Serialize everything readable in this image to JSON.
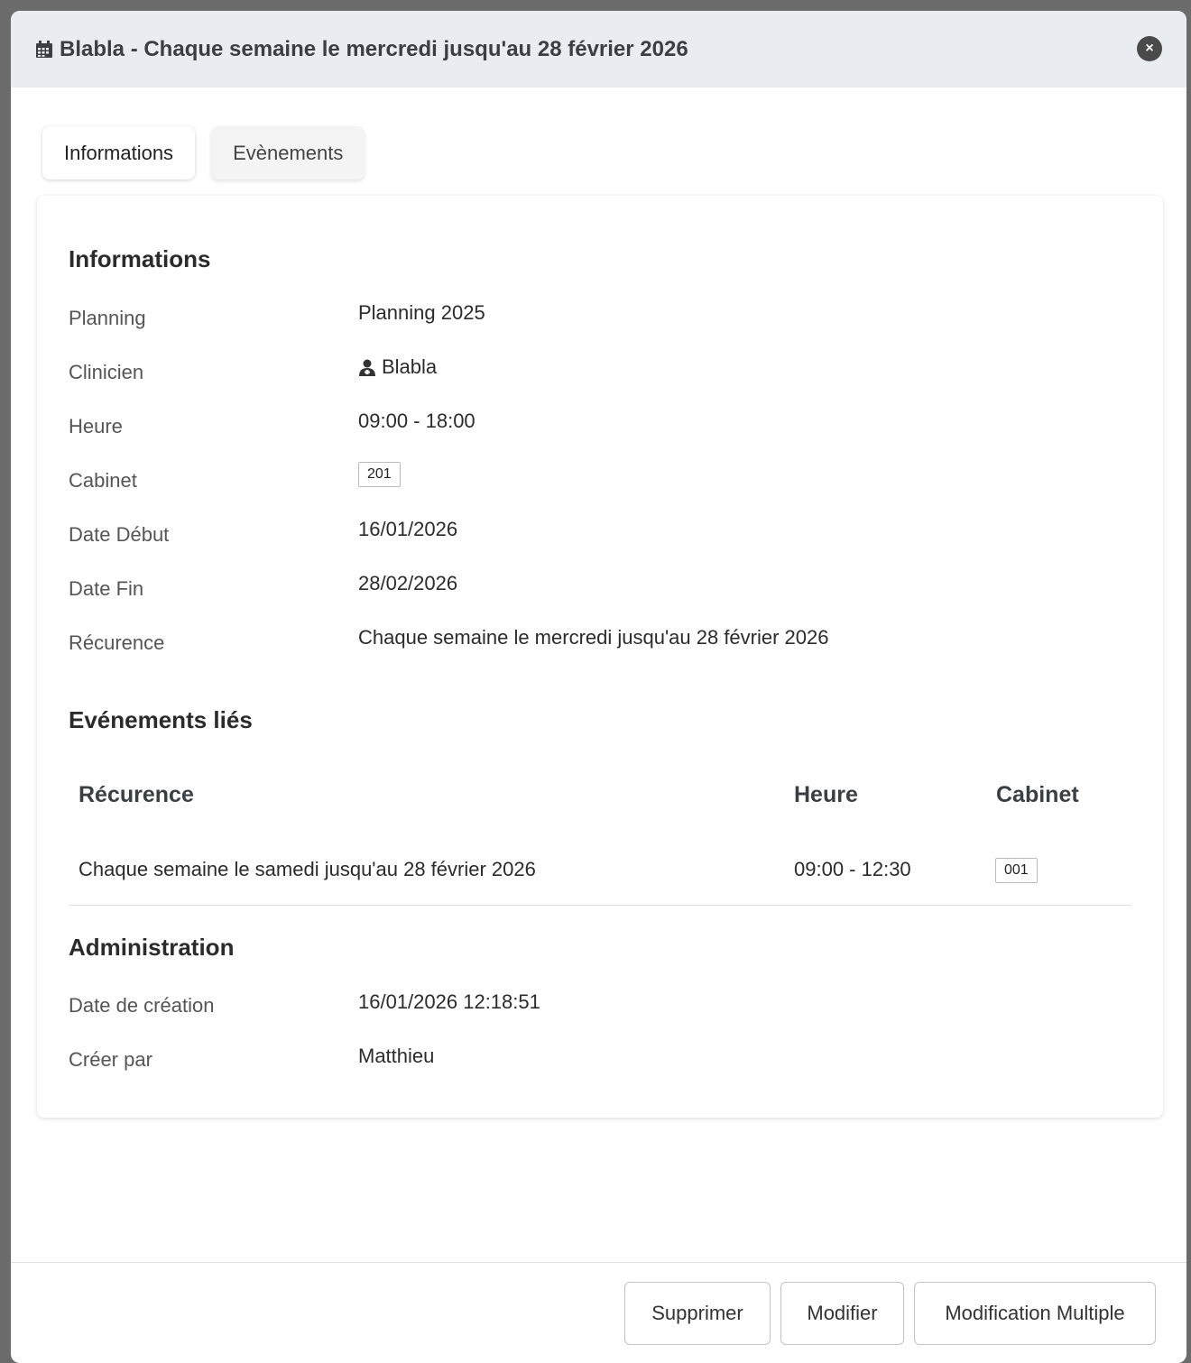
{
  "header": {
    "title": "Blabla - Chaque semaine le mercredi jusqu'au 28 février 2026",
    "close_icon": "×"
  },
  "tabs": [
    {
      "label": "Informations",
      "active": true
    },
    {
      "label": "Evènements",
      "active": false
    }
  ],
  "informations": {
    "title": "Informations",
    "rows": {
      "planning": {
        "label": "Planning",
        "value": "Planning 2025"
      },
      "clinicien": {
        "label": "Clinicien",
        "value": "Blabla"
      },
      "heure": {
        "label": "Heure",
        "value": "09:00 - 18:00"
      },
      "cabinet": {
        "label": "Cabinet",
        "value": "201"
      },
      "date_debut": {
        "label": "Date Début",
        "value": "16/01/2026"
      },
      "date_fin": {
        "label": "Date Fin",
        "value": "28/02/2026"
      },
      "recurrence": {
        "label": "Récurence",
        "value": "Chaque semaine le mercredi jusqu'au 28 février 2026"
      }
    }
  },
  "evenements_lies": {
    "title": "Evénements liés",
    "columns": {
      "recurrence": "Récurence",
      "heure": "Heure",
      "cabinet": "Cabinet"
    },
    "rows": [
      {
        "recurrence": "Chaque semaine le samedi jusqu'au 28 février 2026",
        "heure": "09:00 - 12:30",
        "cabinet": "001"
      }
    ]
  },
  "administration": {
    "title": "Administration",
    "rows": {
      "date_creation": {
        "label": "Date de création",
        "value": "16/01/2026 12:18:51"
      },
      "cree_par": {
        "label": "Créer par",
        "value": "Matthieu"
      }
    }
  },
  "footer": {
    "delete_label": "Supprimer",
    "edit_label": "Modifier",
    "multi_edit_label": "Modification Multiple"
  },
  "colors": {
    "header_bg": "#e9edf2",
    "backdrop": "#6b6b6b"
  }
}
